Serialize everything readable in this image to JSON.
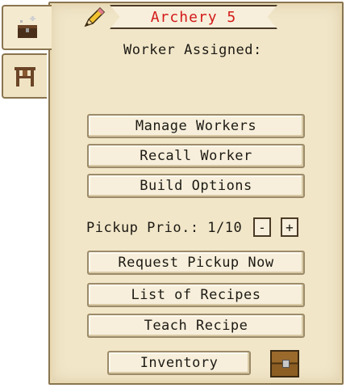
{
  "title": "Archery 5",
  "worker_assigned_label": "Worker Assigned:",
  "buttons": {
    "manage_workers": "Manage Workers",
    "recall_worker": "Recall Worker",
    "build_options": "Build Options",
    "request_pickup": "Request Pickup Now",
    "list_of_recipes": "List of Recipes",
    "teach_recipe": "Teach Recipe",
    "inventory": "Inventory"
  },
  "pickup_priority": {
    "label": "Pickup Prio.: 1/10",
    "minus": "-",
    "plus": "+"
  },
  "colors": {
    "title_text": "#d41a1a",
    "panel": "#f1e6c8"
  },
  "icons": {
    "tab_active": "chest-building-icon",
    "tab_secondary": "workbench-icon",
    "rename": "pencil-icon",
    "inventory": "chest-icon"
  }
}
